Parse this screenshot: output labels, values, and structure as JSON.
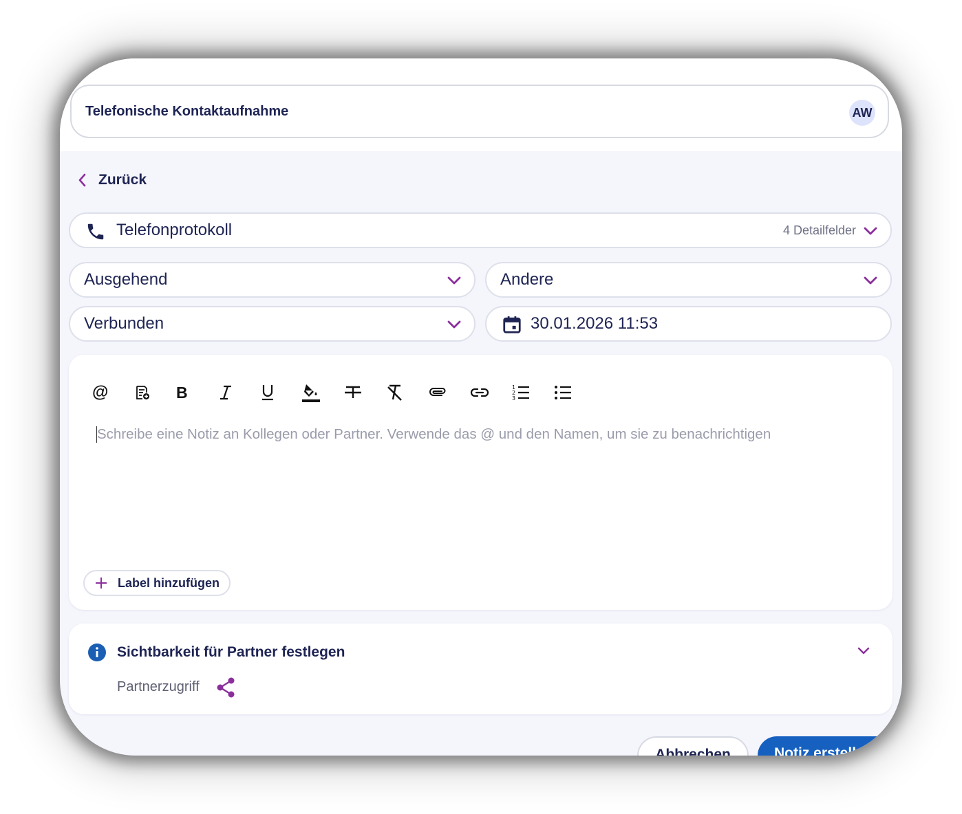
{
  "header": {
    "title": "Telefonische Kontaktaufnahme",
    "avatar_initials": "AW"
  },
  "nav": {
    "back_label": "Zurück"
  },
  "form": {
    "type": {
      "value": "Telefonprotokoll",
      "detail_fields": "4 Detailfelder"
    },
    "direction": {
      "value": "Ausgehend"
    },
    "topic": {
      "value": "Andere"
    },
    "status": {
      "value": "Verbunden"
    },
    "datetime": {
      "value": "30.01.2026 11:53"
    }
  },
  "editor": {
    "toolbar": [
      {
        "name": "mention",
        "glyph": "@"
      },
      {
        "name": "template",
        "glyph": "template-icon"
      },
      {
        "name": "bold",
        "glyph": "B"
      },
      {
        "name": "italic",
        "glyph": "I"
      },
      {
        "name": "underline",
        "glyph": "U"
      },
      {
        "name": "highlight",
        "glyph": "fill-icon"
      },
      {
        "name": "strikethrough",
        "glyph": "strike-icon"
      },
      {
        "name": "clear-format",
        "glyph": "clear-format-icon"
      },
      {
        "name": "attachment",
        "glyph": "paperclip-icon"
      },
      {
        "name": "link",
        "glyph": "link-icon"
      },
      {
        "name": "ordered-list",
        "glyph": "ordered-list-icon"
      },
      {
        "name": "bullet-list",
        "glyph": "bullet-list-icon"
      }
    ],
    "placeholder": "Schreibe eine Notiz an Kollegen oder Partner. Verwende das @ und den Namen, um sie zu benachrichtigen",
    "add_label": "Label hinzufügen"
  },
  "visibility": {
    "title": "Sichtbarkeit für Partner festlegen",
    "access_label": "Partnerzugriff"
  },
  "actions": {
    "cancel": "Abbrechen",
    "create": "Notiz erstellen"
  },
  "colors": {
    "accent": "#8b2f9c",
    "primary": "#1660bf",
    "text": "#1e2453",
    "info": "#1a5fb4"
  }
}
